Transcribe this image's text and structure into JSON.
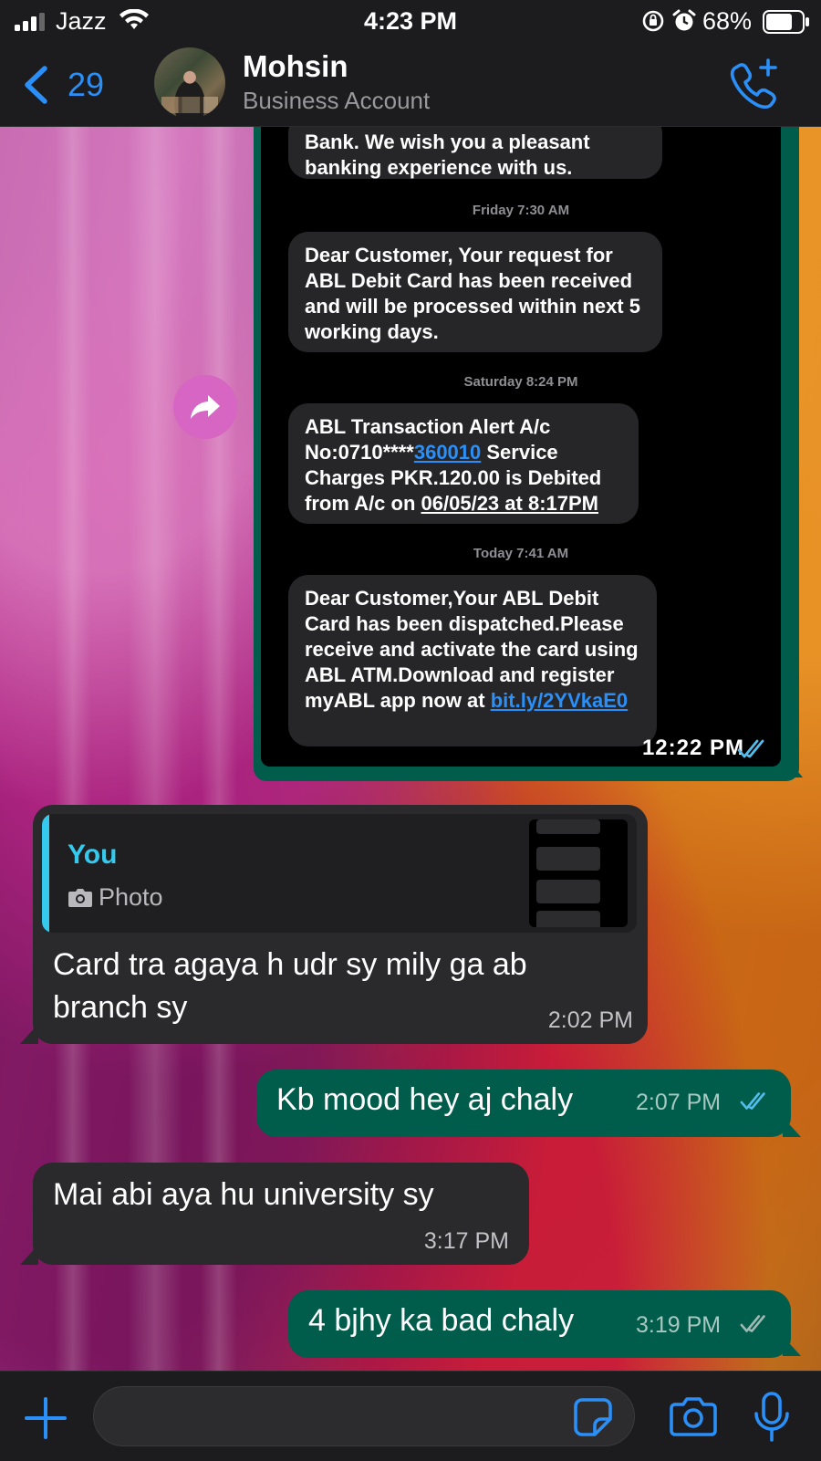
{
  "status_bar": {
    "carrier": "Jazz",
    "time": "4:23 PM",
    "battery": "68%"
  },
  "header": {
    "back_count": "29",
    "contact_name": "Mohsin",
    "contact_subtitle": "Business Account"
  },
  "forwarded_image": {
    "partial_top_text": "Bank. We wish you a pleasant banking experience with us.",
    "sms": [
      {
        "date": "Friday 7:30 AM",
        "text": "Dear Customer, Your request for ABL Debit Card has been received and will be processed within next 5 working days."
      },
      {
        "date": "Saturday 8:24 PM",
        "text_pre": "ABL Transaction Alert A/c No:0710****",
        "link": "360010",
        "text_mid": " Service Charges PKR.120.00 is Debited from A/c on ",
        "text_underlined": "06/05/23 at 8:17PM"
      },
      {
        "date": "Today 7:41 AM",
        "text_pre": "Dear Customer,Your ABL Debit Card has been dispatched.Please receive and activate the card using ABL ATM.Download and register myABL app now at ",
        "link": "bit.ly/2YVkaE0"
      }
    ],
    "time": "12:22 PM",
    "read_status": "read"
  },
  "messages": [
    {
      "direction": "incoming",
      "quote_author": "You",
      "quote_kind": "Photo",
      "text": "Card tra agaya h udr sy mily ga ab branch sy",
      "time": "2:02 PM"
    },
    {
      "direction": "outgoing",
      "text": "Kb mood hey aj chaly",
      "time": "2:07 PM",
      "read_status": "read"
    },
    {
      "direction": "incoming",
      "text": "Mai abi aya hu university sy",
      "time": "3:17 PM"
    },
    {
      "direction": "outgoing",
      "text": "4 bjhy ka bad chaly",
      "time": "3:19 PM",
      "read_status": "delivered"
    }
  ],
  "composer": {
    "placeholder": ""
  },
  "colors": {
    "accent_blue": "#2b8ff8",
    "outgoing_bubble": "#005c4b",
    "incoming_bubble": "#2a2a2c",
    "quote_accent": "#35c9ee",
    "read_tick": "#53bdeb"
  },
  "icons": {
    "back": "chevron-left-icon",
    "call": "phone-plus-icon",
    "forward": "forward-arrow-icon",
    "attach": "plus-icon",
    "sticker": "sticker-icon",
    "camera": "camera-icon",
    "mic": "microphone-icon"
  }
}
